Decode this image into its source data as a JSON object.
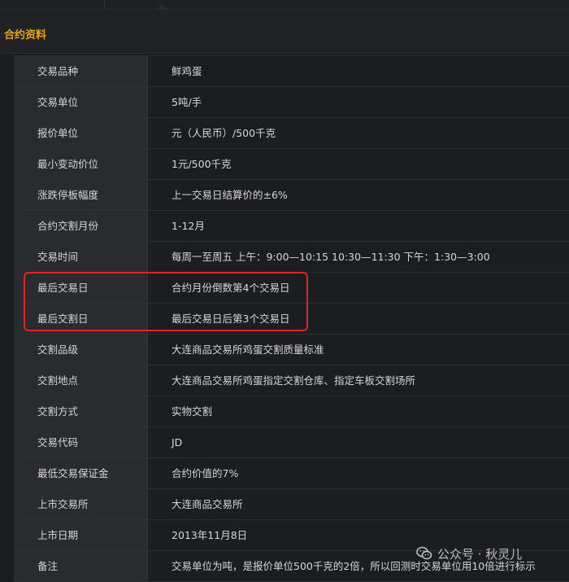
{
  "section": {
    "title": "合约资料"
  },
  "contract_rows": [
    {
      "label": "交易品种",
      "value": "鲜鸡蛋"
    },
    {
      "label": "交易单位",
      "value": "5吨/手"
    },
    {
      "label": "报价单位",
      "value": "元（人民币）/500千克"
    },
    {
      "label": "最小变动价位",
      "value": "1元/500千克"
    },
    {
      "label": "涨跌停板幅度",
      "value": "上一交易日结算价的±6%"
    },
    {
      "label": "合约交割月份",
      "value": "1-12月"
    },
    {
      "label": "交易时间",
      "value": "每周一至周五 上午：9:00—10:15 10:30—11:30 下午：1:30—3:00"
    },
    {
      "label": "最后交易日",
      "value": "合约月份倒数第4个交易日"
    },
    {
      "label": "最后交割日",
      "value": "最后交易日后第3个交易日"
    },
    {
      "label": "交割品级",
      "value": "大连商品交易所鸡蛋交割质量标准"
    },
    {
      "label": "交割地点",
      "value": "大连商品交易所鸡蛋指定交割仓库、指定车板交割场所"
    },
    {
      "label": "交割方式",
      "value": "实物交割"
    },
    {
      "label": "交易代码",
      "value": "JD"
    },
    {
      "label": "最低交易保证金",
      "value": "合约价值的7%"
    },
    {
      "label": "上市交易所",
      "value": "大连商品交易所"
    },
    {
      "label": "上市日期",
      "value": "2013年11月8日"
    },
    {
      "label": "备注",
      "value": "交易单位为吨，是报价单位500千克的2倍，所以回测时交易单位用10倍进行标示"
    }
  ],
  "highlight": {
    "color": "#e02424",
    "covers_rows": [
      "最后交易日",
      "最后交割日"
    ]
  },
  "watermark": {
    "icon": "wechat-official-account-icon",
    "text": "公众号 · 秋灵儿"
  },
  "colors": {
    "accent": "#e8a317",
    "label_bg": "#2a2b2f",
    "value_bg": "#1c1d20"
  }
}
